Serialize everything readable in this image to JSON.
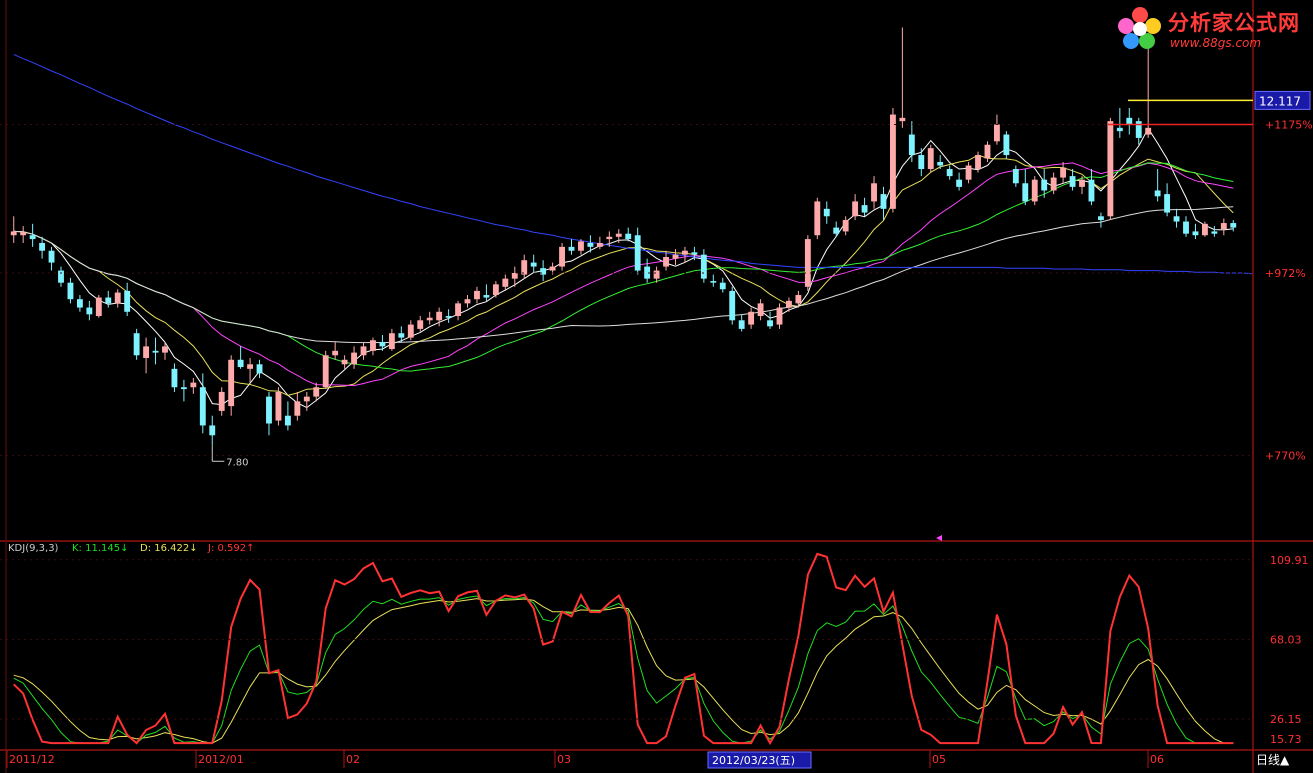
{
  "chart_data": [
    {
      "type": "candlestick",
      "title": "",
      "xlabel": "",
      "ylabel": "",
      "ylim": [
        7.0,
        13.6
      ],
      "scale": "log",
      "grid": false,
      "price_axis": {
        "levels": [
          {
            "value": 12.117,
            "label": "12.117",
            "kind": "current_price"
          },
          {
            "value": 11.75,
            "label": "+1175%",
            "kind": "grid"
          },
          {
            "value": 9.72,
            "label": "+972%",
            "kind": "grid"
          },
          {
            "value": 7.7,
            "label": "+770%",
            "kind": "grid"
          }
        ]
      },
      "annotations": [
        {
          "label": "7.80",
          "value": 7.8,
          "index": 21
        }
      ],
      "candles": [
        [
          10.2,
          10.45,
          10.1,
          10.25
        ],
        [
          10.2,
          10.32,
          10.1,
          10.24
        ],
        [
          10.2,
          10.35,
          10.05,
          10.15
        ],
        [
          10.1,
          10.18,
          9.9,
          10.0
        ],
        [
          10.0,
          10.05,
          9.75,
          9.85
        ],
        [
          9.75,
          9.8,
          9.55,
          9.6
        ],
        [
          9.6,
          9.66,
          9.35,
          9.4
        ],
        [
          9.4,
          9.45,
          9.25,
          9.3
        ],
        [
          9.3,
          9.38,
          9.15,
          9.22
        ],
        [
          9.2,
          9.45,
          9.18,
          9.42
        ],
        [
          9.42,
          9.5,
          9.3,
          9.35
        ],
        [
          9.35,
          9.52,
          9.3,
          9.48
        ],
        [
          9.5,
          9.6,
          9.2,
          9.25
        ],
        [
          9.0,
          9.05,
          8.7,
          8.75
        ],
        [
          8.72,
          8.95,
          8.55,
          8.85
        ],
        [
          8.8,
          8.95,
          8.65,
          8.78
        ],
        [
          8.78,
          8.9,
          8.7,
          8.85
        ],
        [
          8.6,
          8.66,
          8.35,
          8.4
        ],
        [
          8.4,
          8.48,
          8.25,
          8.38
        ],
        [
          8.4,
          8.5,
          8.33,
          8.45
        ],
        [
          8.4,
          8.55,
          7.92,
          8.0
        ],
        [
          8.0,
          8.1,
          7.8,
          7.9
        ],
        [
          8.15,
          8.4,
          8.1,
          8.35
        ],
        [
          8.2,
          8.75,
          8.1,
          8.7
        ],
        [
          8.7,
          8.85,
          8.6,
          8.62
        ],
        [
          8.6,
          8.72,
          8.45,
          8.65
        ],
        [
          8.65,
          8.7,
          8.5,
          8.55
        ],
        [
          8.3,
          8.35,
          7.9,
          8.02
        ],
        [
          8.05,
          8.4,
          8.0,
          8.35
        ],
        [
          8.1,
          8.25,
          7.95,
          8.0
        ],
        [
          8.1,
          8.35,
          8.05,
          8.25
        ],
        [
          8.25,
          8.35,
          8.15,
          8.3
        ],
        [
          8.3,
          8.45,
          8.25,
          8.4
        ],
        [
          8.4,
          8.8,
          8.38,
          8.75
        ],
        [
          8.75,
          8.9,
          8.7,
          8.8
        ],
        [
          8.65,
          8.75,
          8.6,
          8.7
        ],
        [
          8.65,
          8.85,
          8.6,
          8.78
        ],
        [
          8.75,
          8.9,
          8.7,
          8.85
        ],
        [
          8.8,
          8.95,
          8.75,
          8.92
        ],
        [
          8.9,
          8.98,
          8.8,
          8.85
        ],
        [
          8.82,
          9.05,
          8.8,
          9.0
        ],
        [
          9.0,
          9.08,
          8.9,
          8.95
        ],
        [
          8.95,
          9.15,
          8.92,
          9.1
        ],
        [
          9.05,
          9.2,
          9.02,
          9.15
        ],
        [
          9.15,
          9.25,
          9.1,
          9.18
        ],
        [
          9.15,
          9.3,
          9.08,
          9.25
        ],
        [
          9.2,
          9.28,
          9.12,
          9.18
        ],
        [
          9.2,
          9.38,
          9.15,
          9.35
        ],
        [
          9.35,
          9.45,
          9.3,
          9.4
        ],
        [
          9.4,
          9.55,
          9.35,
          9.5
        ],
        [
          9.45,
          9.58,
          9.38,
          9.42
        ],
        [
          9.45,
          9.62,
          9.42,
          9.58
        ],
        [
          9.55,
          9.7,
          9.5,
          9.65
        ],
        [
          9.65,
          9.8,
          9.55,
          9.72
        ],
        [
          9.7,
          9.95,
          9.65,
          9.88
        ],
        [
          9.85,
          9.95,
          9.72,
          9.8
        ],
        [
          9.78,
          9.88,
          9.62,
          9.7
        ],
        [
          9.75,
          9.85,
          9.7,
          9.8
        ],
        [
          9.8,
          10.1,
          9.75,
          10.05
        ],
        [
          10.05,
          10.15,
          9.95,
          10.0
        ],
        [
          10.0,
          10.15,
          9.95,
          10.12
        ],
        [
          10.1,
          10.2,
          9.98,
          10.05
        ],
        [
          10.05,
          10.18,
          10.02,
          10.1
        ],
        [
          10.15,
          10.25,
          10.05,
          10.18
        ],
        [
          10.18,
          10.28,
          10.1,
          10.22
        ],
        [
          10.22,
          10.3,
          10.12,
          10.15
        ],
        [
          10.2,
          10.3,
          9.7,
          9.75
        ],
        [
          9.8,
          9.9,
          9.6,
          9.65
        ],
        [
          9.65,
          9.8,
          9.6,
          9.75
        ],
        [
          9.8,
          10.0,
          9.75,
          9.92
        ],
        [
          9.9,
          10.02,
          9.82,
          9.95
        ],
        [
          9.95,
          10.05,
          9.85,
          10.0
        ],
        [
          9.98,
          10.05,
          9.88,
          9.95
        ],
        [
          9.95,
          10.02,
          9.6,
          9.65
        ],
        [
          9.62,
          9.7,
          9.55,
          9.6
        ],
        [
          9.6,
          9.66,
          9.48,
          9.52
        ],
        [
          9.5,
          9.55,
          9.1,
          9.15
        ],
        [
          9.15,
          9.22,
          9.02,
          9.05
        ],
        [
          9.1,
          9.3,
          9.05,
          9.25
        ],
        [
          9.2,
          9.4,
          9.15,
          9.35
        ],
        [
          9.15,
          9.25,
          9.05,
          9.08
        ],
        [
          9.1,
          9.35,
          9.05,
          9.3
        ],
        [
          9.3,
          9.42,
          9.25,
          9.38
        ],
        [
          9.35,
          9.5,
          9.3,
          9.45
        ],
        [
          9.55,
          10.2,
          9.5,
          10.15
        ],
        [
          10.2,
          10.7,
          10.15,
          10.65
        ],
        [
          10.55,
          10.65,
          10.35,
          10.45
        ],
        [
          10.3,
          10.38,
          10.18,
          10.22
        ],
        [
          10.25,
          10.45,
          10.2,
          10.4
        ],
        [
          10.45,
          10.75,
          10.4,
          10.65
        ],
        [
          10.6,
          10.7,
          10.45,
          10.5
        ],
        [
          10.65,
          11.0,
          10.55,
          10.9
        ],
        [
          10.75,
          10.85,
          10.4,
          10.55
        ],
        [
          10.55,
          12.0,
          10.5,
          11.9
        ],
        [
          11.8,
          13.3,
          11.7,
          11.85
        ],
        [
          11.6,
          11.8,
          11.2,
          11.3
        ],
        [
          11.3,
          11.4,
          11.0,
          11.1
        ],
        [
          11.1,
          11.45,
          11.05,
          11.4
        ],
        [
          11.2,
          11.3,
          11.1,
          11.15
        ],
        [
          11.1,
          11.15,
          10.95,
          11.0
        ],
        [
          10.95,
          11.05,
          10.8,
          10.85
        ],
        [
          10.95,
          11.2,
          10.9,
          11.15
        ],
        [
          11.1,
          11.35,
          11.05,
          11.3
        ],
        [
          11.25,
          11.5,
          11.2,
          11.45
        ],
        [
          11.5,
          11.9,
          11.45,
          11.75
        ],
        [
          11.6,
          11.65,
          11.25,
          11.3
        ],
        [
          11.1,
          11.15,
          10.85,
          10.9
        ],
        [
          10.9,
          11.1,
          10.6,
          10.65
        ],
        [
          10.65,
          11.0,
          10.6,
          10.95
        ],
        [
          10.95,
          11.1,
          10.7,
          10.8
        ],
        [
          10.8,
          11.05,
          10.75,
          10.98
        ],
        [
          10.98,
          11.2,
          10.9,
          11.12
        ],
        [
          11.0,
          11.1,
          10.8,
          10.85
        ],
        [
          10.85,
          11.0,
          10.75,
          10.95
        ],
        [
          10.95,
          11.1,
          10.6,
          10.65
        ],
        [
          10.45,
          10.5,
          10.3,
          10.4
        ],
        [
          10.45,
          11.85,
          10.4,
          11.8
        ],
        [
          11.7,
          12.0,
          11.55,
          11.65
        ],
        [
          11.85,
          12.0,
          11.6,
          11.75
        ],
        [
          11.8,
          11.85,
          11.45,
          11.55
        ],
        [
          11.6,
          13.0,
          11.55,
          11.7
        ],
        [
          10.8,
          11.1,
          10.65,
          10.72
        ],
        [
          10.75,
          10.9,
          10.45,
          10.5
        ],
        [
          10.45,
          10.55,
          10.3,
          10.38
        ],
        [
          10.38,
          10.45,
          10.18,
          10.22
        ],
        [
          10.25,
          10.35,
          10.15,
          10.2
        ],
        [
          10.2,
          10.38,
          10.18,
          10.35
        ],
        [
          10.25,
          10.32,
          10.18,
          10.22
        ],
        [
          10.28,
          10.42,
          10.2,
          10.36
        ],
        [
          10.36,
          10.4,
          10.25,
          10.3
        ]
      ],
      "series": [
        {
          "color": "#ffffff",
          "period": 5
        },
        {
          "color": "#e8e05a",
          "period": 10
        },
        {
          "color": "#ff44ff",
          "period": 20
        },
        {
          "color": "#33ee33",
          "period": 30
        },
        {
          "color": "#dddddd",
          "period": 60
        },
        {
          "color": "#3344ff",
          "values": [
            12.85,
            12.78,
            12.72,
            12.65,
            12.58,
            12.52,
            12.45,
            12.38,
            12.32,
            12.25,
            12.18,
            12.12,
            12.06,
            11.99,
            11.93,
            11.87,
            11.81,
            11.75,
            11.7,
            11.64,
            11.59,
            11.53,
            11.48,
            11.43,
            11.38,
            11.33,
            11.28,
            11.23,
            11.18,
            11.14,
            11.09,
            11.05,
            11.0,
            10.96,
            10.92,
            10.88,
            10.84,
            10.8,
            10.76,
            10.72,
            10.69,
            10.65,
            10.62,
            10.58,
            10.55,
            10.52,
            10.49,
            10.46,
            10.43,
            10.4,
            10.37,
            10.34,
            10.32,
            10.29,
            10.27,
            10.24,
            10.22,
            10.2,
            10.17,
            10.15,
            10.13,
            10.11,
            10.09,
            10.07,
            10.05,
            10.03,
            10.02,
            10.0,
            9.98,
            9.97,
            9.95,
            9.94,
            9.92,
            9.91,
            9.89,
            9.88,
            9.87,
            9.86,
            9.84,
            9.83,
            9.82,
            9.81,
            9.8,
            9.79,
            9.79,
            9.79,
            9.79,
            9.79,
            9.79,
            9.79,
            9.79,
            9.79,
            9.79,
            9.79,
            9.79,
            9.79,
            9.79,
            9.79,
            9.79,
            9.79,
            9.79,
            9.79,
            9.79,
            9.79,
            9.79,
            9.78,
            9.78,
            9.78,
            9.78,
            9.78,
            9.77,
            9.77,
            9.77,
            9.77,
            9.76,
            9.76,
            9.76,
            9.76,
            9.75,
            9.75,
            9.75,
            9.75,
            9.74,
            9.74,
            9.74,
            9.73,
            9.73,
            9.73,
            9.72,
            9.72,
            9.72,
            9.71
          ]
        }
      ],
      "selected_date": "2012/03/23(五)",
      "x_tick_labels": [
        "2011/12",
        "2012/01",
        "02",
        "03",
        "05",
        "06"
      ],
      "period_label": "日线"
    },
    {
      "type": "line",
      "title": "KDJ(9,3,3)",
      "legend": [
        {
          "label": "K: 11.145",
          "arrow": "↓",
          "color": "#22dd22"
        },
        {
          "label": "D: 16.422",
          "arrow": "↓",
          "color": "#e8e05a"
        },
        {
          "label": "J: 0.592",
          "arrow": "↑",
          "color": "#ff3333"
        }
      ],
      "ylim": [
        12.5,
        114
      ],
      "y_tick_labels": [
        "109.91",
        "68.03",
        "26.15",
        "15.73"
      ],
      "x": "same as candles",
      "series": [
        {
          "name": "K",
          "color": "#22dd22"
        },
        {
          "name": "D",
          "color": "#e8e05a"
        },
        {
          "name": "J",
          "color": "#ff3333"
        }
      ]
    }
  ]
}
